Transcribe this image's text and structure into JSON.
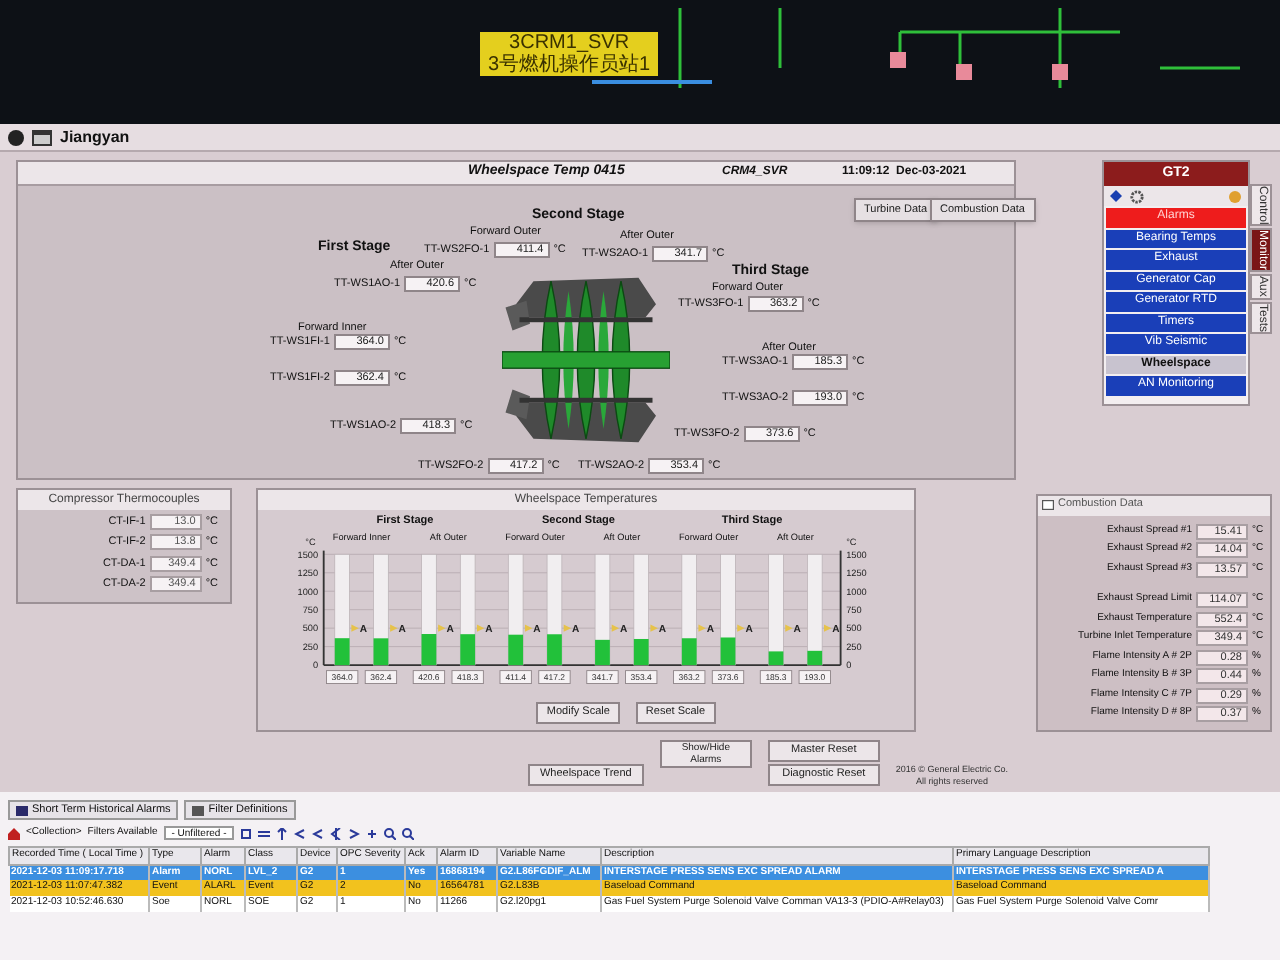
{
  "top_monitor": {
    "station_label": [
      "3CRM1_SVR",
      "3号燃机操作员站1"
    ]
  },
  "window": {
    "title": "Jiangyan"
  },
  "header": {
    "screen_title": "Wheelspace Temp 0415",
    "server": "CRM4_SVR",
    "timestamp": "11:09:12  Dec-03-2021",
    "buttons": [
      "Turbine Data",
      "Combustion Data"
    ]
  },
  "turbine_diagram": {
    "stage_labels": [
      "First Stage",
      "Second Stage",
      "Third Stage"
    ],
    "position_labels": [
      "After Outer",
      "Forward Inner",
      "Forward Outer",
      "After Outer",
      "Forward Outer",
      "After Outer"
    ],
    "sensors": [
      {
        "tag": "TT-WS1AO-1",
        "value": "420.6",
        "unit": "°C"
      },
      {
        "tag": "TT-WS1FI-1",
        "value": "364.0",
        "unit": "°C"
      },
      {
        "tag": "TT-WS1FI-2",
        "value": "362.4",
        "unit": "°C"
      },
      {
        "tag": "TT-WS1AO-2",
        "value": "418.3",
        "unit": "°C"
      },
      {
        "tag": "TT-WS2FO-1",
        "value": "411.4",
        "unit": "°C"
      },
      {
        "tag": "TT-WS2AO-1",
        "value": "341.7",
        "unit": "°C"
      },
      {
        "tag": "TT-WS2FO-2",
        "value": "417.2",
        "unit": "°C"
      },
      {
        "tag": "TT-WS2AO-2",
        "value": "353.4",
        "unit": "°C"
      },
      {
        "tag": "TT-WS3FO-1",
        "value": "363.2",
        "unit": "°C"
      },
      {
        "tag": "TT-WS3AO-1",
        "value": "185.3",
        "unit": "°C"
      },
      {
        "tag": "TT-WS3AO-2",
        "value": "193.0",
        "unit": "°C"
      },
      {
        "tag": "TT-WS3FO-2",
        "value": "373.6",
        "unit": "°C"
      }
    ]
  },
  "compressor_thermocouples": {
    "title": "Compressor Thermocouples",
    "rows": [
      {
        "tag": "CT-IF-1",
        "value": "13.0",
        "unit": "°C"
      },
      {
        "tag": "CT-IF-2",
        "value": "13.8",
        "unit": "°C"
      },
      {
        "tag": "CT-DA-1",
        "value": "349.4",
        "unit": "°C"
      },
      {
        "tag": "CT-DA-2",
        "value": "349.4",
        "unit": "°C"
      }
    ]
  },
  "wheelspace_temperatures": {
    "title": "Wheelspace Temperatures",
    "stages": [
      {
        "label": "First Stage",
        "groups": [
          "Forward Inner",
          "Aft Outer"
        ]
      },
      {
        "label": "Second Stage",
        "groups": [
          "Forward Outer",
          "Aft Outer"
        ]
      },
      {
        "label": "Third Stage",
        "groups": [
          "Forward Outer",
          "Aft Outer"
        ]
      }
    ],
    "right_axis_unit": "°C",
    "right_axis_ticks": [
      "1500",
      "1250",
      "1000",
      "750",
      "500",
      "250",
      "0"
    ],
    "alarm_marks": [
      "A",
      "A",
      "A",
      "A",
      "A",
      "A",
      "A",
      "A",
      "A",
      "A",
      "A",
      "A"
    ],
    "chart_data": {
      "type": "bar",
      "ylabel": "°C",
      "ylim": [
        0,
        1500
      ],
      "yticks": [
        0,
        250,
        500,
        750,
        1000,
        1250,
        1500
      ],
      "values": [
        364.0,
        362.4,
        420.6,
        418.3,
        411.4,
        417.2,
        341.7,
        353.4,
        363.2,
        373.6,
        185.3,
        193.0
      ],
      "value_labels": [
        "364.0",
        "362.4",
        "420.6",
        "418.3",
        "411.4",
        "417.2",
        "341.7",
        "353.4",
        "363.2",
        "373.6",
        "185.3",
        "193.0"
      ],
      "grid": true
    },
    "scale_buttons": [
      "Modify Scale",
      "Reset Scale"
    ]
  },
  "action_buttons": [
    "Show/Hide Alarms",
    "Master Reset",
    "Wheelspace Trend",
    "Diagnostic Reset"
  ],
  "copyright": [
    "2016 © General Electric Co.",
    "All rights reserved"
  ],
  "nav": {
    "title": "GT2",
    "items": [
      {
        "label": "Alarms",
        "kind": "alarm",
        "selected": false
      },
      {
        "label": "Bearing Temps",
        "kind": "page",
        "selected": false
      },
      {
        "label": "Exhaust",
        "kind": "page",
        "selected": false
      },
      {
        "label": "Generator Cap",
        "kind": "page",
        "selected": false
      },
      {
        "label": "Generator RTD",
        "kind": "page",
        "selected": false
      },
      {
        "label": "Timers",
        "kind": "page",
        "selected": false
      },
      {
        "label": "Vib Seismic",
        "kind": "page",
        "selected": false
      },
      {
        "label": "Wheelspace",
        "kind": "page",
        "selected": true
      },
      {
        "label": "AN Monitoring",
        "kind": "page",
        "selected": false
      }
    ],
    "side_tabs": [
      {
        "label": "Control",
        "selected": false
      },
      {
        "label": "Monitor",
        "selected": true
      },
      {
        "label": "Aux",
        "selected": false
      },
      {
        "label": "Tests",
        "selected": false
      }
    ]
  },
  "combustion_data": {
    "title": "Combustion Data",
    "rows": [
      {
        "label": "Exhaust Spread #1",
        "value": "15.41",
        "unit": "°C"
      },
      {
        "label": "Exhaust Spread #2",
        "value": "14.04",
        "unit": "°C"
      },
      {
        "label": "Exhaust Spread #3",
        "value": "13.57",
        "unit": "°C"
      },
      {
        "label": "Exhaust Spread Limit",
        "value": "114.07",
        "unit": "°C"
      },
      {
        "label": "Exhaust Temperature",
        "value": "552.4",
        "unit": "°C"
      },
      {
        "label": "Turbine Inlet Temperature",
        "value": "349.4",
        "unit": "°C"
      },
      {
        "label": "Flame Intensity A # 2P",
        "value": "0.28",
        "unit": "%"
      },
      {
        "label": "Flame Intensity B # 3P",
        "value": "0.44",
        "unit": "%"
      },
      {
        "label": "Flame Intensity C # 7P",
        "value": "0.29",
        "unit": "%"
      },
      {
        "label": "Flame Intensity D # 8P",
        "value": "0.37",
        "unit": "%"
      }
    ]
  },
  "alarm_viewer": {
    "tabs": [
      "Short Term Historical Alarms",
      "Filter Definitions"
    ],
    "collection": "<Collection>",
    "filters_label": "Filters Available",
    "filter": "- Unfiltered -",
    "columns": [
      "Recorded Time ( Local Time )",
      "Type",
      "Alarm",
      "Class",
      "Device",
      "OPC Severity",
      "Ack",
      "Alarm ID",
      "Variable Name",
      "Description",
      "Primary Language Description"
    ],
    "rows": [
      {
        "selected": true,
        "color": "#3c8fe0",
        "cells": [
          "2021-12-03 11:09:17.718",
          "Alarm",
          "NORL",
          "LVL_2",
          "G2",
          "1",
          "Yes",
          "16868194",
          "G2.L86FGDIF_ALM",
          "INTERSTAGE PRESS SENS EXC SPREAD ALARM",
          "INTERSTAGE PRESS SENS EXC SPREAD A"
        ]
      },
      {
        "selected": false,
        "color": "#f2c21e",
        "cells": [
          "2021-12-03 11:07:47.382",
          "Event",
          "ALARL",
          "Event",
          "G2",
          "2",
          "No",
          "16564781",
          "G2.L83B",
          "Baseload Command",
          "Baseload Command"
        ]
      },
      {
        "selected": false,
        "color": "#ffffff",
        "cells": [
          "2021-12-03 10:52:46.630",
          "Soe",
          "NORL",
          "SOE",
          "G2",
          "1",
          "No",
          "11266",
          "G2.l20pg1",
          "Gas Fuel System Purge Solenoid Valve Comman VA13-3 (PDIO-A#Relay03)",
          "Gas Fuel System Purge Solenoid Valve Comr"
        ]
      }
    ]
  }
}
